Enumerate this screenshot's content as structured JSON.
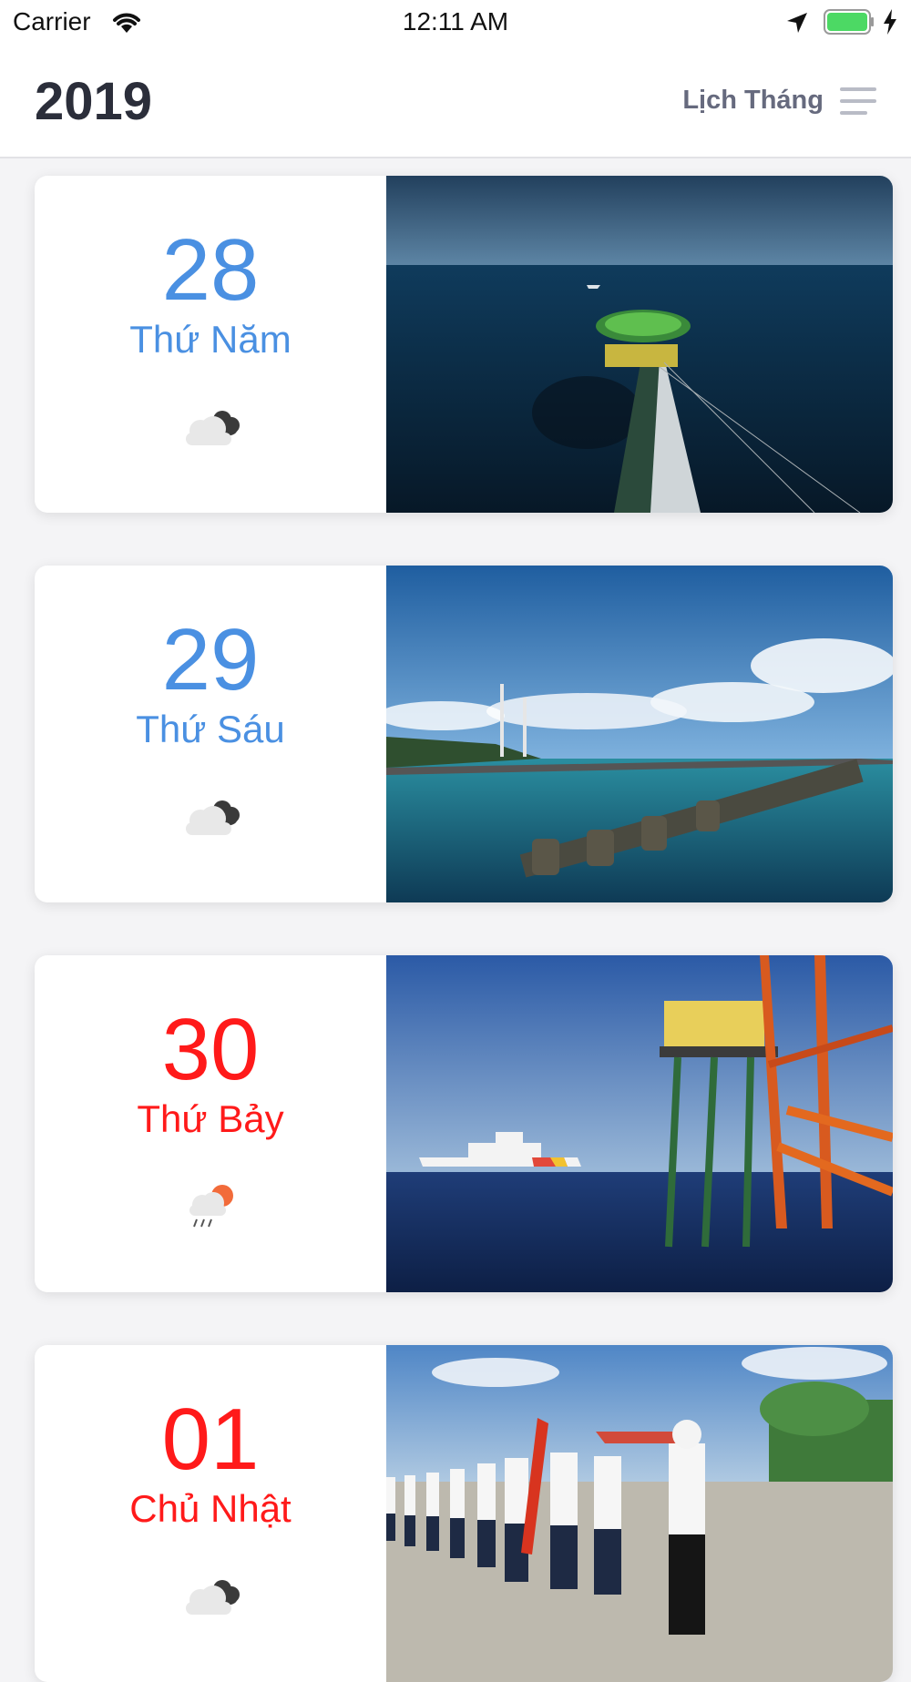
{
  "status": {
    "carrier": "Carrier",
    "time": "12:11 AM",
    "icons": [
      "wifi-icon",
      "location-arrow-icon",
      "battery-icon",
      "charging-bolt-icon"
    ],
    "battery_color": "#4cd964"
  },
  "header": {
    "title": "2019",
    "month_view_label": "Lịch Tháng",
    "menu_icon": "hamburger-menu-icon"
  },
  "colors": {
    "weekday": "#4a90e2",
    "weekend": "#ff1a1a"
  },
  "days": [
    {
      "day": "28",
      "weekday": "Thứ Năm",
      "weather": "cloudy-night-icon",
      "photo": "offshore-platform-aerial-photo"
    },
    {
      "day": "29",
      "weekday": "Thứ Sáu",
      "weather": "cloudy-night-icon",
      "photo": "island-breakwater-photo"
    },
    {
      "day": "30",
      "weekday": "Thứ Bảy",
      "weather": "sun-rain-icon",
      "photo": "coast-guard-ship-and-platform-photo"
    },
    {
      "day": "01",
      "weekday": "Chủ Nhật",
      "weather": "cloudy-night-icon",
      "photo": "sailors-marching-parade-photo"
    }
  ]
}
